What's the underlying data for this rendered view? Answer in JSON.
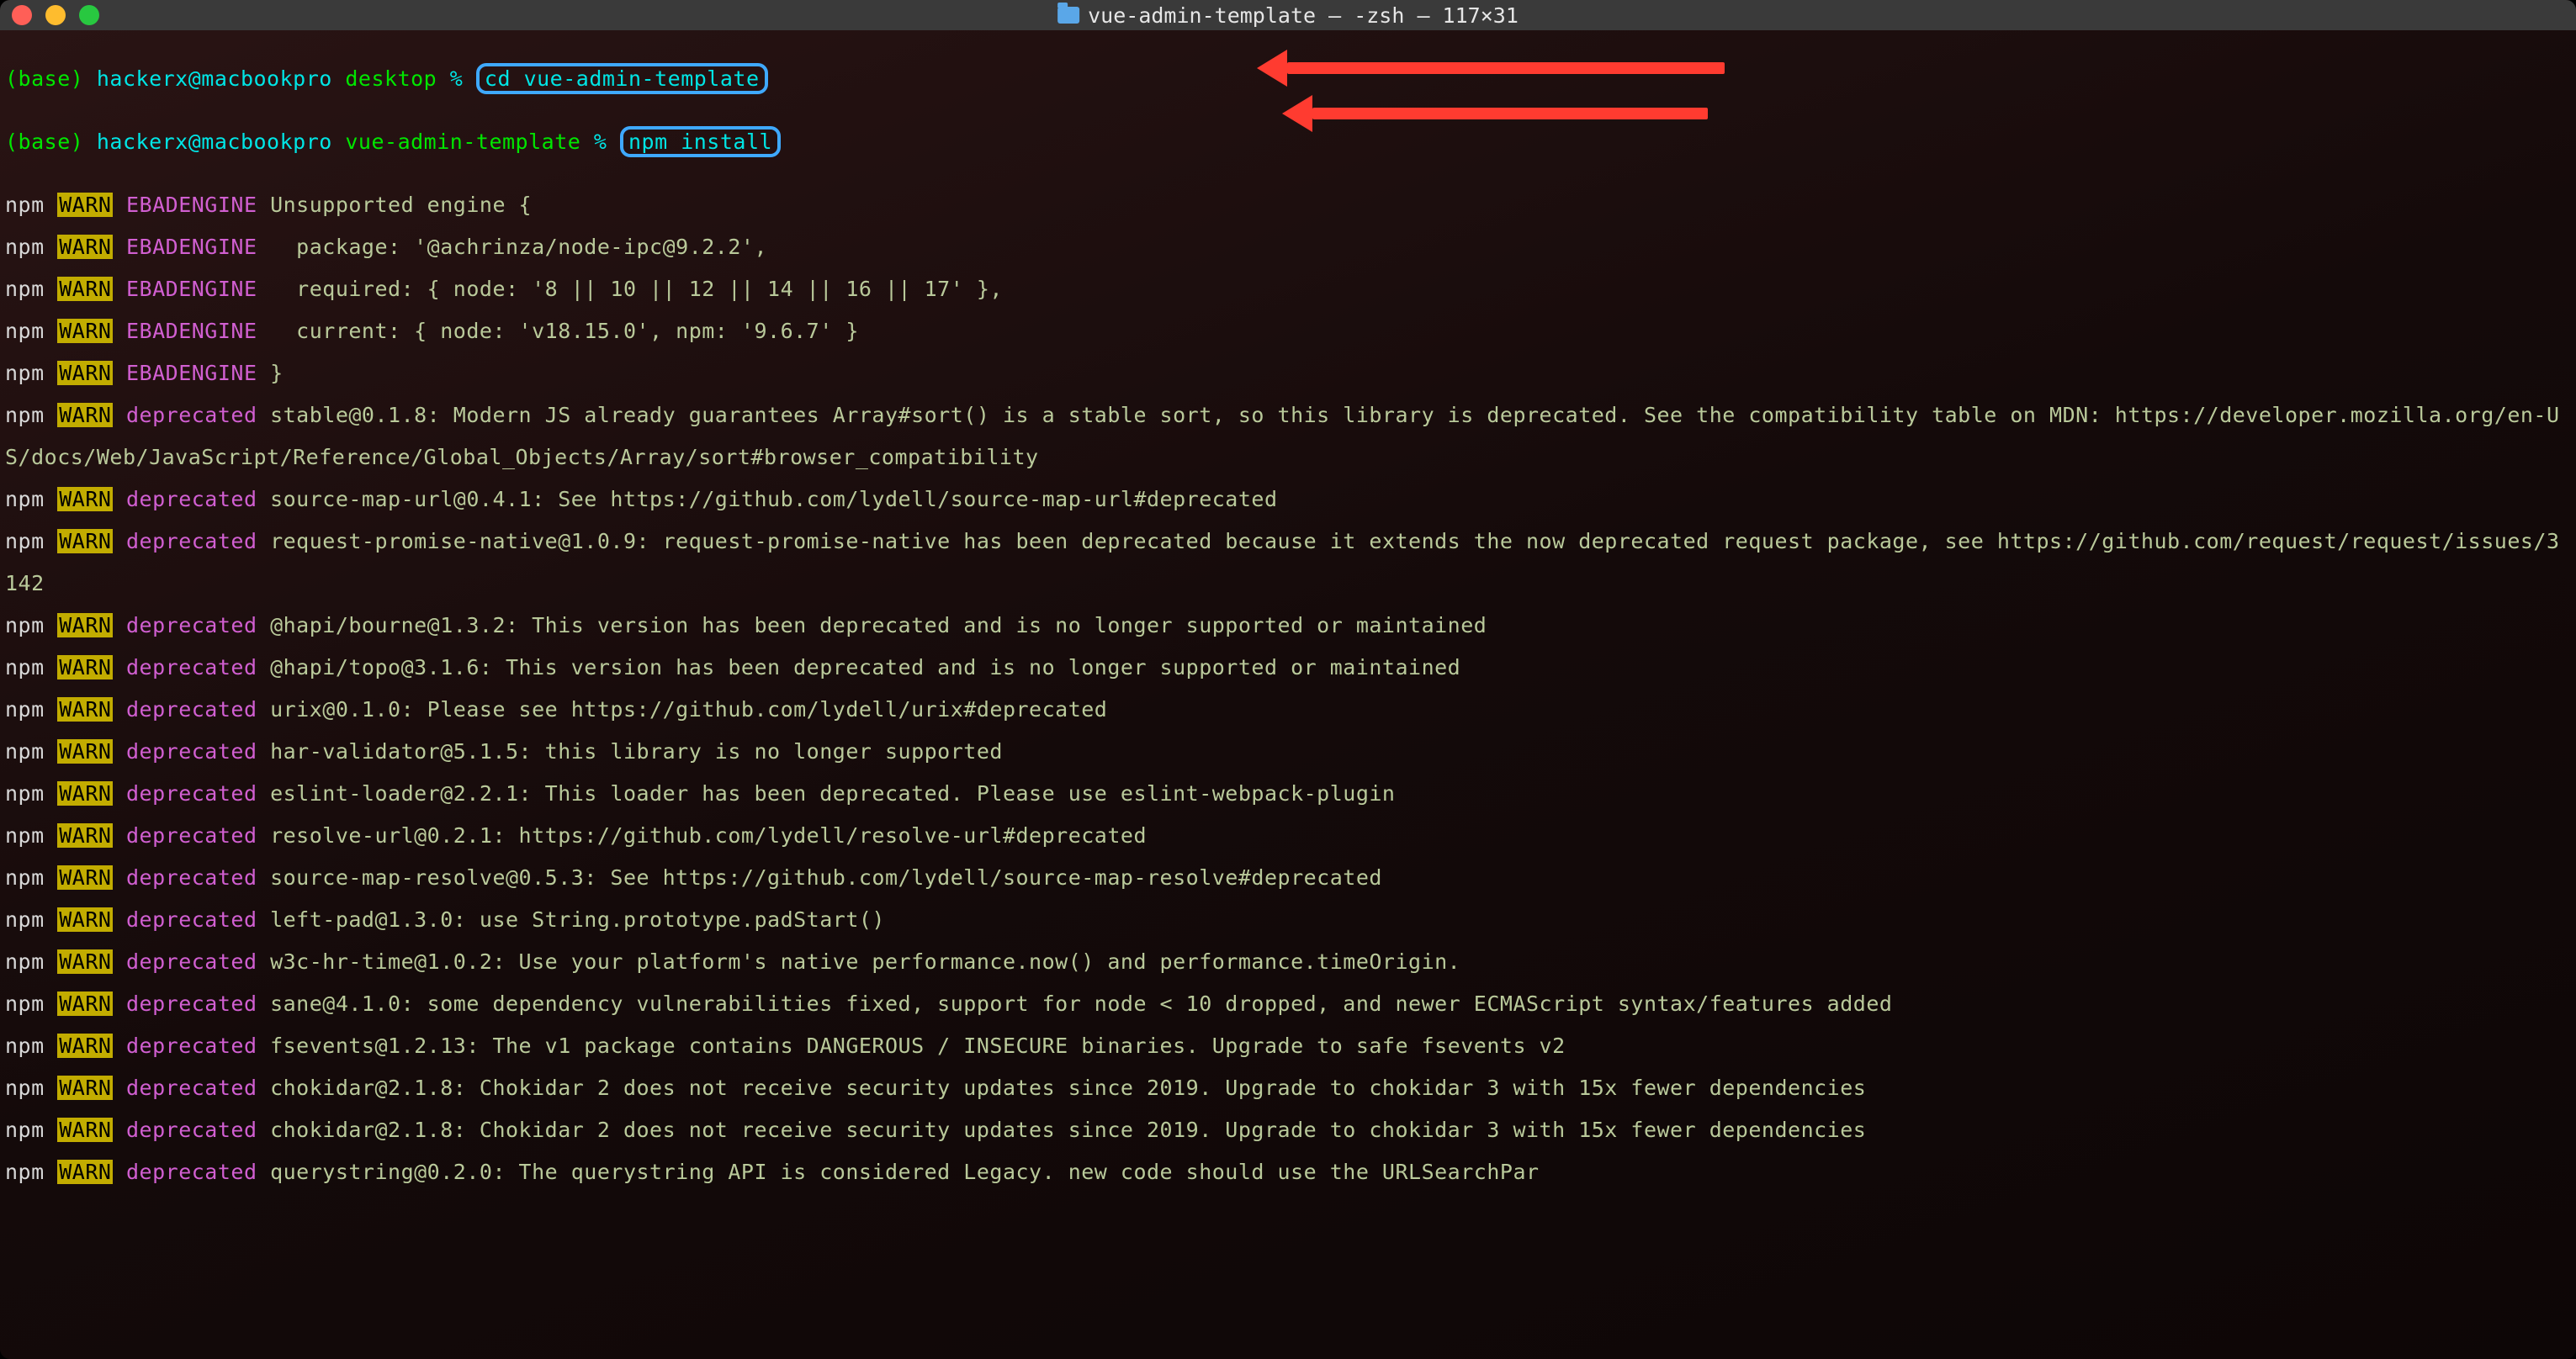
{
  "title": "vue-admin-template — -zsh — 117×31",
  "prompt1": {
    "base": "(base)",
    "userhost": "hackerx@macbookpro",
    "cwd": "desktop",
    "symbol": "%",
    "cmd": "cd vue-admin-template"
  },
  "prompt2": {
    "base": "(base)",
    "userhost": "hackerx@macbookpro",
    "cwd": "vue-admin-template",
    "symbol": "%",
    "cmd": "npm install"
  },
  "labels": {
    "npm": "npm",
    "warn": "WARN",
    "deprecated": "deprecated",
    "ebadengine": "EBADENGINE"
  },
  "ebadengine": [
    "Unsupported engine {",
    "  package: '@achrinza/node-ipc@9.2.2',",
    "  required: { node: '8 || 10 || 12 || 14 || 16 || 17' },",
    "  current: { node: 'v18.15.0', npm: '9.6.7' }",
    "}"
  ],
  "deprecated": [
    "stable@0.1.8: Modern JS already guarantees Array#sort() is a stable sort, so this library is deprecated. See the compatibility table on MDN: https://developer.mozilla.org/en-US/docs/Web/JavaScript/Reference/Global_Objects/Array/sort#browser_compatibility",
    "source-map-url@0.4.1: See https://github.com/lydell/source-map-url#deprecated",
    "request-promise-native@1.0.9: request-promise-native has been deprecated because it extends the now deprecated request package, see https://github.com/request/request/issues/3142",
    "@hapi/bourne@1.3.2: This version has been deprecated and is no longer supported or maintained",
    "@hapi/topo@3.1.6: This version has been deprecated and is no longer supported or maintained",
    "urix@0.1.0: Please see https://github.com/lydell/urix#deprecated",
    "har-validator@5.1.5: this library is no longer supported",
    "eslint-loader@2.2.1: This loader has been deprecated. Please use eslint-webpack-plugin",
    "resolve-url@0.2.1: https://github.com/lydell/resolve-url#deprecated",
    "source-map-resolve@0.5.3: See https://github.com/lydell/source-map-resolve#deprecated",
    "left-pad@1.3.0: use String.prototype.padStart()",
    "w3c-hr-time@1.0.2: Use your platform's native performance.now() and performance.timeOrigin.",
    "sane@4.1.0: some dependency vulnerabilities fixed, support for node < 10 dropped, and newer ECMAScript syntax/features added",
    "fsevents@1.2.13: The v1 package contains DANGEROUS / INSECURE binaries. Upgrade to safe fsevents v2",
    "chokidar@2.1.8: Chokidar 2 does not receive security updates since 2019. Upgrade to chokidar 3 with 15x fewer dependencies",
    "chokidar@2.1.8: Chokidar 2 does not receive security updates since 2019. Upgrade to chokidar 3 with 15x fewer dependencies",
    "querystring@0.2.0: The querystring API is considered Legacy. new code should use the URLSearchPar"
  ]
}
